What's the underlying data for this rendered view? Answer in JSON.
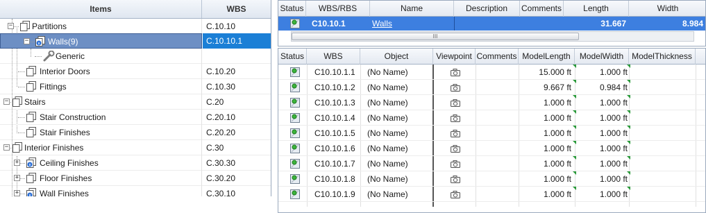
{
  "tree": {
    "headers": {
      "items": "Items",
      "wbs": "WBS"
    },
    "rows": [
      {
        "label": "Partitions",
        "wbs": "C.10.10"
      },
      {
        "label": "Walls(9)",
        "wbs": "C.10.10.1",
        "selected": true
      },
      {
        "label": "Generic",
        "wbs": ""
      },
      {
        "label": "Interior Doors",
        "wbs": "C.10.20"
      },
      {
        "label": "Fittings",
        "wbs": "C.10.30"
      },
      {
        "label": "Stairs",
        "wbs": "C.20"
      },
      {
        "label": "Stair Construction",
        "wbs": "C.20.10"
      },
      {
        "label": "Stair Finishes",
        "wbs": "C.20.20"
      },
      {
        "label": "Interior Finishes",
        "wbs": "C.30"
      },
      {
        "label": "Ceiling Finishes",
        "wbs": "C.30.30"
      },
      {
        "label": "Floor Finishes",
        "wbs": "C.30.20"
      },
      {
        "label": "Wall Finishes",
        "wbs": "C.30.10"
      }
    ]
  },
  "top_grid": {
    "headers": {
      "status": "Status",
      "wbsrbs": "WBS/RBS",
      "name": "Name",
      "description": "Description",
      "comments": "Comments",
      "length": "Length",
      "width": "Width"
    },
    "row": {
      "wbsrbs": "C10.10.1",
      "name": "Walls",
      "length": "31.667",
      "width": "8.984"
    },
    "scroll_grip": "III"
  },
  "bottom_grid": {
    "headers": {
      "status": "Status",
      "wbs": "WBS",
      "object": "Object",
      "viewpoint": "Viewpoint",
      "comments": "Comments",
      "model_length": "ModelLength",
      "model_width": "ModelWidth",
      "model_thickness": "ModelThickness"
    },
    "rows": [
      {
        "wbs": "C10.10.1.1",
        "object": "(No Name)",
        "model_length": "15.000 ft",
        "model_width": "1.000 ft"
      },
      {
        "wbs": "C10.10.1.2",
        "object": "(No Name)",
        "model_length": "9.667 ft",
        "model_width": "0.984 ft"
      },
      {
        "wbs": "C10.10.1.3",
        "object": "(No Name)",
        "model_length": "1.000 ft",
        "model_width": "1.000 ft"
      },
      {
        "wbs": "C10.10.1.4",
        "object": "(No Name)",
        "model_length": "1.000 ft",
        "model_width": "1.000 ft"
      },
      {
        "wbs": "C10.10.1.5",
        "object": "(No Name)",
        "model_length": "1.000 ft",
        "model_width": "1.000 ft"
      },
      {
        "wbs": "C10.10.1.6",
        "object": "(No Name)",
        "model_length": "1.000 ft",
        "model_width": "1.000 ft"
      },
      {
        "wbs": "C10.10.1.7",
        "object": "(No Name)",
        "model_length": "1.000 ft",
        "model_width": "1.000 ft"
      },
      {
        "wbs": "C10.10.1.8",
        "object": "(No Name)",
        "model_length": "1.000 ft",
        "model_width": "1.000 ft"
      },
      {
        "wbs": "C10.10.1.9",
        "object": "(No Name)",
        "model_length": "1.000 ft",
        "model_width": "1.000 ft"
      }
    ]
  },
  "colors": {
    "selection_blue": "#3d7fe0",
    "tree_selection": "#6d8fc4",
    "wbs_selection": "#1b7fd6",
    "header_bg": "#e4e9f1"
  }
}
